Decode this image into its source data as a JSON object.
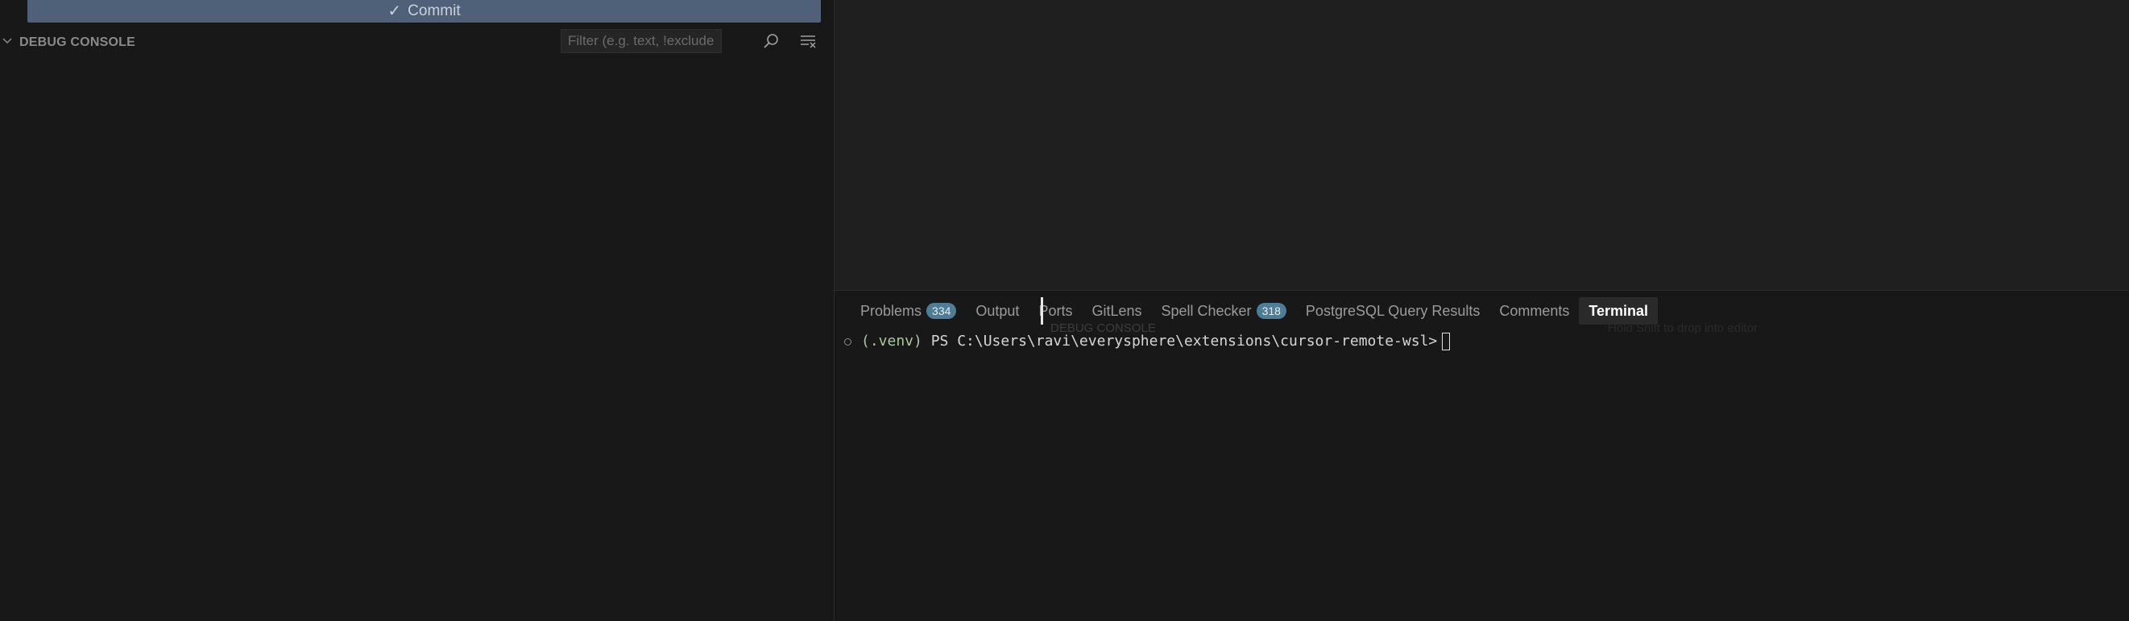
{
  "scm": {
    "commit_label": "Commit"
  },
  "debug_console": {
    "title": "DEBUG CONSOLE",
    "filter_placeholder": "Filter (e.g. text, !exclude..."
  },
  "panel": {
    "tabs": [
      {
        "label": "Problems",
        "badge": "334"
      },
      {
        "label": "Output"
      },
      {
        "label": "Ports"
      },
      {
        "label": "GitLens"
      },
      {
        "label": "Spell Checker",
        "badge": "318"
      },
      {
        "label": "PostgreSQL Query Results"
      },
      {
        "label": "Comments"
      },
      {
        "label": "Terminal",
        "active": true
      }
    ],
    "drag_ghost_label": "DEBUG CONSOLE",
    "ghost_hint": "Hold Shift to drop into editor"
  },
  "terminal": {
    "venv": "(.venv)",
    "prompt": "PS C:\\Users\\ravi\\everysphere\\extensions\\cursor-remote-wsl>"
  },
  "colors": {
    "commit_button": "#4f6178",
    "badge": "#4e7d98",
    "background": "#181818"
  }
}
